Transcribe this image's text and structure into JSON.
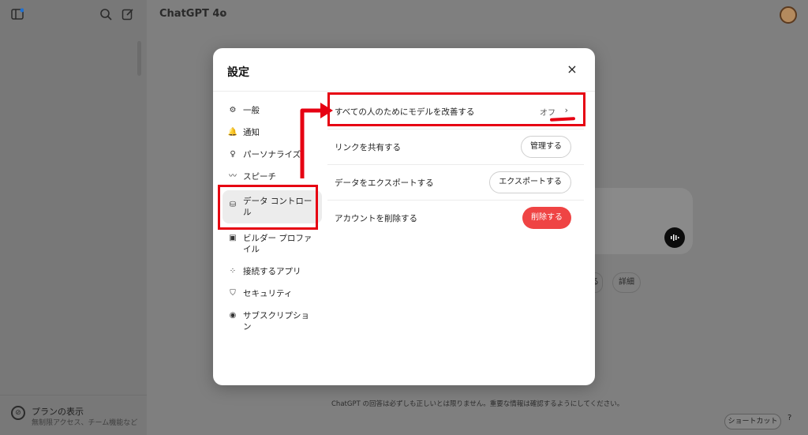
{
  "app": {
    "model_name": "ChatGPT 4o",
    "model_chevron": "⌄",
    "headline_fragment": "?",
    "chips": [
      "る",
      "詳細"
    ],
    "disclaimer": "ChatGPT の回答は必ずしも正しいとは限りません。重要な情報は確認するようにしてください。",
    "shortcut_label": "ショートカット",
    "help_label": "?"
  },
  "sidebar": {
    "plan_title": "プランの表示",
    "plan_subtitle": "無制限アクセス、チーム機能など",
    "plan_icon_glyph": "⊘"
  },
  "settings": {
    "title": "設定",
    "close_glyph": "×",
    "nav": [
      {
        "label": "一般",
        "icon": "⚙"
      },
      {
        "label": "通知",
        "icon": "🔔"
      },
      {
        "label": "パーソナライズ",
        "icon": "♀"
      },
      {
        "label": "スピーチ",
        "icon": "〰"
      },
      {
        "label": "データ コントロール",
        "icon": "⛁",
        "active": true
      },
      {
        "label": "ビルダー プロファイル",
        "icon": "▣"
      },
      {
        "label": "接続するアプリ",
        "icon": "⁘"
      },
      {
        "label": "セキュリティ",
        "icon": "⛉"
      },
      {
        "label": "サブスクリプション",
        "icon": "◉"
      }
    ],
    "rows": {
      "improve_model": {
        "label": "すべての人のためにモデルを改善する",
        "value": "オフ",
        "chevron": "›"
      },
      "shared_links": {
        "label": "リンクを共有する",
        "button": "管理する"
      },
      "export": {
        "label": "データをエクスポートする",
        "button": "エクスポートする"
      },
      "delete_account": {
        "label": "アカウントを削除する",
        "button": "削除する"
      }
    }
  },
  "colors": {
    "annotation_red": "#e60012",
    "danger": "#ef4444"
  }
}
